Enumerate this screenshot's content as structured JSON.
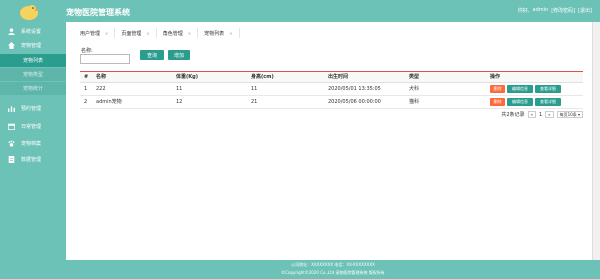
{
  "app": {
    "title": "宠物医院管理系统",
    "colors": {
      "teal": "#6cc2b6",
      "accent": "#2a9d8f",
      "danger": "#ff6a3a",
      "divider": "#d9534f"
    }
  },
  "header": {
    "welcome": "你好,",
    "user": "admin",
    "modify_password": "[修改密码]",
    "logout": "[退出]"
  },
  "sidebar": {
    "items": [
      {
        "label": "系统设置",
        "icon": "user-icon"
      },
      {
        "label": "宠物管理",
        "icon": "home-icon"
      },
      {
        "label": "宠物列表",
        "icon": ""
      },
      {
        "label": "宠物类型",
        "icon": ""
      },
      {
        "label": "宠物统计",
        "icon": ""
      },
      {
        "label": "预约管理",
        "icon": "chart-icon"
      },
      {
        "label": "日常管理",
        "icon": "calendar-icon"
      },
      {
        "label": "宠物档案",
        "icon": "paw-icon"
      },
      {
        "label": "数据管理",
        "icon": "document-icon"
      }
    ]
  },
  "tabs": [
    {
      "label": "用户管理"
    },
    {
      "label": "页面管理"
    },
    {
      "label": "角色管理"
    },
    {
      "label": "宠物列表"
    }
  ],
  "search": {
    "label": "名称:",
    "query_button": "查询",
    "add_button": "增加"
  },
  "table": {
    "headers": [
      "#",
      "名称",
      "体重(Kg)",
      "身高(cm)",
      "出生时间",
      "类型",
      "操作"
    ],
    "rows": [
      {
        "index": "1",
        "name": "222",
        "weight": "11",
        "height": "11",
        "birth": "2020/05/01 13:35:05",
        "type": "犬科"
      },
      {
        "index": "2",
        "name": "admin宠物",
        "weight": "12",
        "height": "21",
        "birth": "2020/05/06 00:00:00",
        "type": "猫科"
      }
    ],
    "actions": {
      "delete": "删除",
      "edit": "编辑信息",
      "view": "查看详细"
    }
  },
  "pager": {
    "total": "共2条记录",
    "prev": "«",
    "page": "1",
    "next": "»",
    "per_page": "每页10条"
  },
  "footer": {
    "line1": "公司地址：XXXXXXXX 电话：XX-XXXXXXXX",
    "line2": "©Copyright©2020 Co.,Ltd 宠物医院管理系统 版权所有"
  }
}
